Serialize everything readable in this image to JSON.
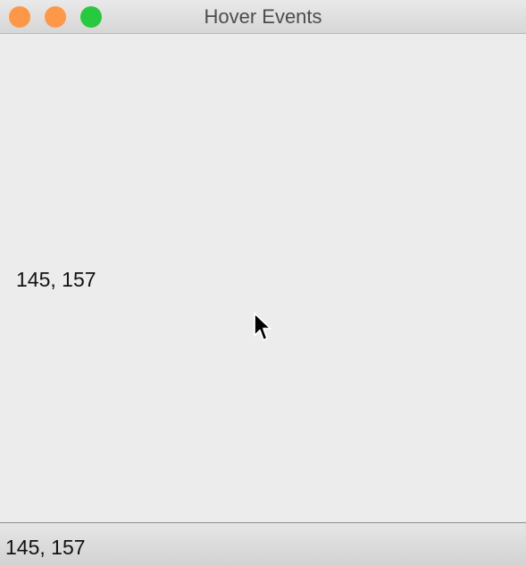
{
  "window": {
    "title": "Hover Events",
    "controls": {
      "close_color": "#ff9749",
      "minimize_color": "#ff9749",
      "zoom_color": "#27c93f"
    }
  },
  "canvas": {
    "coordinate_text": "145, 157",
    "cursor_icon": "arrow-cursor-icon"
  },
  "status_bar": {
    "text": "145, 157"
  }
}
